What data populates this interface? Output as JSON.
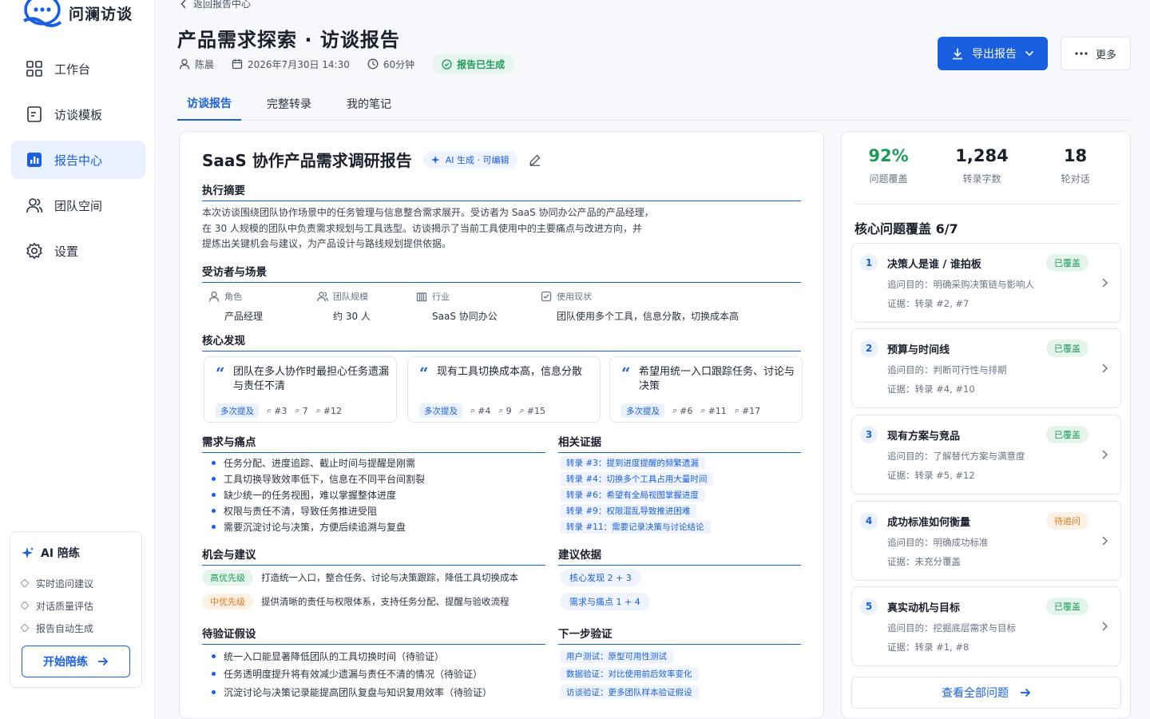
{
  "app": {
    "name": "问澜访谈"
  },
  "nav": [
    {
      "label": "工作台",
      "icon": "dashboard-icon"
    },
    {
      "label": "访谈模板",
      "icon": "template-icon"
    },
    {
      "label": "报告中心",
      "icon": "report-icon",
      "active": true
    },
    {
      "label": "团队空间",
      "icon": "team-icon"
    },
    {
      "label": "设置",
      "icon": "gear-icon"
    }
  ],
  "ai_box": {
    "title": "AI 陪练",
    "items": [
      "实时追问建议",
      "对话质量评估",
      "报告自动生成"
    ],
    "button": "开始陪练"
  },
  "header": {
    "back": "返回报告中心",
    "title": "产品需求探索 · 访谈报告",
    "author": "陈晨",
    "datetime": "2026年7月30日 14:30",
    "duration": "60分钟",
    "status": "报告已生成",
    "export": "导出报告",
    "more": "更多"
  },
  "tabs": [
    {
      "label": "访谈报告",
      "active": true
    },
    {
      "label": "完整转录"
    },
    {
      "label": "我的笔记"
    }
  ],
  "report": {
    "title": "SaaS 协作产品需求调研报告",
    "ai_tag": "AI 生成 · 可编辑",
    "summary": {
      "heading": "执行摘要",
      "lines": [
        "本次访谈围绕团队协作场景中的任务管理与信息整合需求展开。受访者为 SaaS 协同办公产品的产品经理，",
        "在 30 人规模的团队中负责需求规划与工具选型。访谈揭示了当前工具使用中的主要痛点与改进方向，并",
        "提炼出关键机会与建议，为产品设计与路线规划提供依据。"
      ]
    },
    "profile": {
      "heading": "受访者与场景",
      "fields": [
        {
          "label": "角色",
          "value": "产品经理"
        },
        {
          "label": "团队规模",
          "value": "约 30 人"
        },
        {
          "label": "行业",
          "value": "SaaS 协同办公"
        },
        {
          "label": "使用现状",
          "value": "团队使用多个工具，信息分散，切换成本高"
        }
      ]
    },
    "findings": {
      "heading": "核心发现",
      "items": [
        {
          "text": "团队在多人协作时最担心任务遗漏与责任不清",
          "tag": "多次提及",
          "refs": [
            "#3",
            "7",
            "#12"
          ]
        },
        {
          "text": "现有工具切换成本高，信息分散",
          "tag": "多次提及",
          "refs": [
            "#4",
            "9",
            "#15"
          ]
        },
        {
          "text": "希望用统一入口跟踪任务、讨论与决策",
          "tag": "多次提及",
          "refs": [
            "#6",
            "#11",
            "#17"
          ]
        }
      ]
    },
    "needs": {
      "heading": "需求与痛点",
      "evidence_heading": "相关证据",
      "items": [
        "任务分配、进度追踪、截止时间与提醒是刚需",
        "工具切换导致效率低下，信息在不同平台间割裂",
        "缺少统一的任务视图，难以掌握整体进度",
        "权限与责任不清，导致任务推进受阻",
        "需要沉淀讨论与决策，方便后续追溯与复盘"
      ],
      "evidence": [
        "转录 #3：提到进度提醒的频繁遗漏",
        "转录 #4：切换多个工具占用大量时间",
        "转录 #6：希望有全局视图掌握进度",
        "转录 #9：权限混乱导致推进困难",
        "转录 #11：需要记录决策与讨论结论"
      ]
    },
    "opportunities": {
      "heading": "机会与建议",
      "basis_heading": "建议依据",
      "items": [
        {
          "priority": "高优先级",
          "level": "high",
          "text": "打造统一入口，整合任务、讨论与决策跟踪，降低工具切换成本",
          "basis": "核心发现 2 + 3"
        },
        {
          "priority": "中优先级",
          "level": "mid",
          "text": "提供清晰的责任与权限体系，支持任务分配、提醒与验收流程",
          "basis": "需求与痛点 1 + 4"
        }
      ]
    },
    "hypotheses": {
      "heading": "待验证假设",
      "next_heading": "下一步验证",
      "items": [
        "统一入口能显著降低团队的工具切换时间（待验证）",
        "任务透明度提升将有效减少遗漏与责任不清的情况（待验证）",
        "沉淀讨论与决策记录能提高团队复盘与知识复用效率（待验证）"
      ],
      "next": [
        "用户测试：原型可用性测试",
        "数据验证：对比使用前后效率变化",
        "访谈验证：更多团队样本验证假设"
      ]
    }
  },
  "side": {
    "stats": [
      {
        "value": "92%",
        "label": "问题覆盖"
      },
      {
        "value": "1,284",
        "label": "转录字数"
      },
      {
        "value": "18",
        "label": "轮对话"
      }
    ],
    "coverage_title": "核心问题覆盖 6/7",
    "questions": [
      {
        "num": "1",
        "title": "决策人是谁 / 谁拍板",
        "badge": "已覆盖",
        "state": "ok",
        "purpose": "追问目的：明确采购决策链与影响人",
        "evidence": "证据：转录 #2, #7"
      },
      {
        "num": "2",
        "title": "预算与时间线",
        "badge": "已覆盖",
        "state": "ok",
        "purpose": "追问目的：判断可行性与排期",
        "evidence": "证据：转录 #4, #10"
      },
      {
        "num": "3",
        "title": "现有方案与竞品",
        "badge": "已覆盖",
        "state": "ok",
        "purpose": "追问目的：了解替代方案与满意度",
        "evidence": "证据：转录 #5, #12"
      },
      {
        "num": "4",
        "title": "成功标准如何衡量",
        "badge": "待追问",
        "state": "pend",
        "purpose": "追问目的：明确成功标准",
        "evidence": "证据：未充分覆盖"
      },
      {
        "num": "5",
        "title": "真实动机与目标",
        "badge": "已覆盖",
        "state": "ok",
        "purpose": "追问目的：挖掘底层需求与目标",
        "evidence": "证据：转录 #1, #8"
      }
    ],
    "view_all": "查看全部问题"
  },
  "colors": {
    "accent": "#1a5fe0",
    "success": "#1d9a5b",
    "warning": "#e07a1f"
  }
}
